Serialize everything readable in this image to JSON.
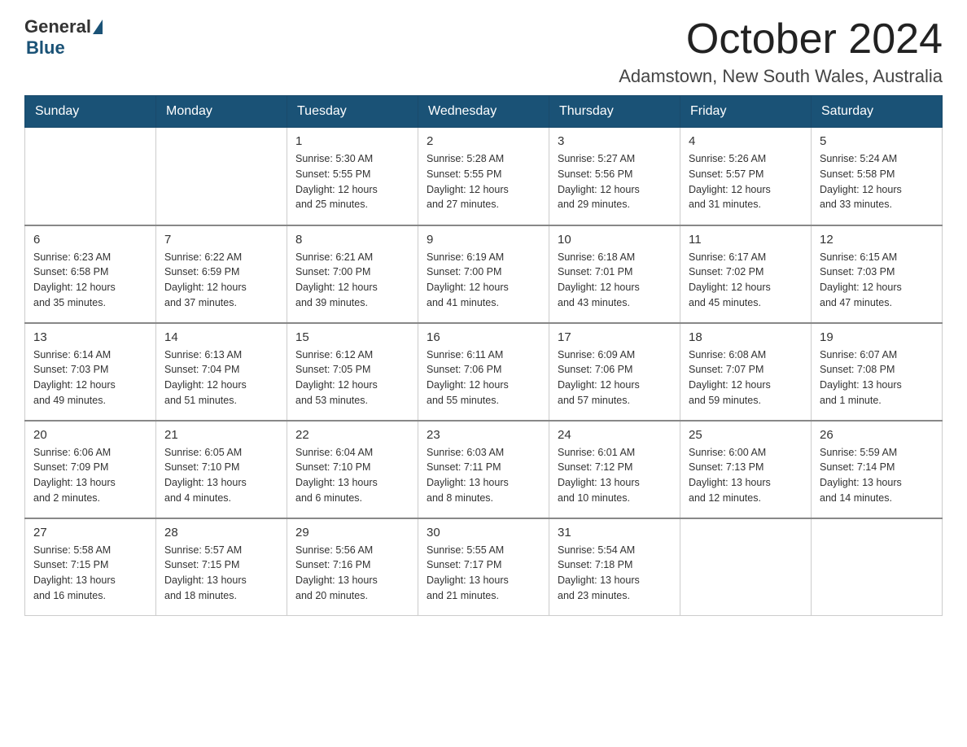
{
  "logo": {
    "general": "General",
    "blue": "Blue"
  },
  "title": "October 2024",
  "location": "Adamstown, New South Wales, Australia",
  "weekdays": [
    "Sunday",
    "Monday",
    "Tuesday",
    "Wednesday",
    "Thursday",
    "Friday",
    "Saturday"
  ],
  "weeks": [
    [
      {
        "day": "",
        "info": ""
      },
      {
        "day": "",
        "info": ""
      },
      {
        "day": "1",
        "info": "Sunrise: 5:30 AM\nSunset: 5:55 PM\nDaylight: 12 hours\nand 25 minutes."
      },
      {
        "day": "2",
        "info": "Sunrise: 5:28 AM\nSunset: 5:55 PM\nDaylight: 12 hours\nand 27 minutes."
      },
      {
        "day": "3",
        "info": "Sunrise: 5:27 AM\nSunset: 5:56 PM\nDaylight: 12 hours\nand 29 minutes."
      },
      {
        "day": "4",
        "info": "Sunrise: 5:26 AM\nSunset: 5:57 PM\nDaylight: 12 hours\nand 31 minutes."
      },
      {
        "day": "5",
        "info": "Sunrise: 5:24 AM\nSunset: 5:58 PM\nDaylight: 12 hours\nand 33 minutes."
      }
    ],
    [
      {
        "day": "6",
        "info": "Sunrise: 6:23 AM\nSunset: 6:58 PM\nDaylight: 12 hours\nand 35 minutes."
      },
      {
        "day": "7",
        "info": "Sunrise: 6:22 AM\nSunset: 6:59 PM\nDaylight: 12 hours\nand 37 minutes."
      },
      {
        "day": "8",
        "info": "Sunrise: 6:21 AM\nSunset: 7:00 PM\nDaylight: 12 hours\nand 39 minutes."
      },
      {
        "day": "9",
        "info": "Sunrise: 6:19 AM\nSunset: 7:00 PM\nDaylight: 12 hours\nand 41 minutes."
      },
      {
        "day": "10",
        "info": "Sunrise: 6:18 AM\nSunset: 7:01 PM\nDaylight: 12 hours\nand 43 minutes."
      },
      {
        "day": "11",
        "info": "Sunrise: 6:17 AM\nSunset: 7:02 PM\nDaylight: 12 hours\nand 45 minutes."
      },
      {
        "day": "12",
        "info": "Sunrise: 6:15 AM\nSunset: 7:03 PM\nDaylight: 12 hours\nand 47 minutes."
      }
    ],
    [
      {
        "day": "13",
        "info": "Sunrise: 6:14 AM\nSunset: 7:03 PM\nDaylight: 12 hours\nand 49 minutes."
      },
      {
        "day": "14",
        "info": "Sunrise: 6:13 AM\nSunset: 7:04 PM\nDaylight: 12 hours\nand 51 minutes."
      },
      {
        "day": "15",
        "info": "Sunrise: 6:12 AM\nSunset: 7:05 PM\nDaylight: 12 hours\nand 53 minutes."
      },
      {
        "day": "16",
        "info": "Sunrise: 6:11 AM\nSunset: 7:06 PM\nDaylight: 12 hours\nand 55 minutes."
      },
      {
        "day": "17",
        "info": "Sunrise: 6:09 AM\nSunset: 7:06 PM\nDaylight: 12 hours\nand 57 minutes."
      },
      {
        "day": "18",
        "info": "Sunrise: 6:08 AM\nSunset: 7:07 PM\nDaylight: 12 hours\nand 59 minutes."
      },
      {
        "day": "19",
        "info": "Sunrise: 6:07 AM\nSunset: 7:08 PM\nDaylight: 13 hours\nand 1 minute."
      }
    ],
    [
      {
        "day": "20",
        "info": "Sunrise: 6:06 AM\nSunset: 7:09 PM\nDaylight: 13 hours\nand 2 minutes."
      },
      {
        "day": "21",
        "info": "Sunrise: 6:05 AM\nSunset: 7:10 PM\nDaylight: 13 hours\nand 4 minutes."
      },
      {
        "day": "22",
        "info": "Sunrise: 6:04 AM\nSunset: 7:10 PM\nDaylight: 13 hours\nand 6 minutes."
      },
      {
        "day": "23",
        "info": "Sunrise: 6:03 AM\nSunset: 7:11 PM\nDaylight: 13 hours\nand 8 minutes."
      },
      {
        "day": "24",
        "info": "Sunrise: 6:01 AM\nSunset: 7:12 PM\nDaylight: 13 hours\nand 10 minutes."
      },
      {
        "day": "25",
        "info": "Sunrise: 6:00 AM\nSunset: 7:13 PM\nDaylight: 13 hours\nand 12 minutes."
      },
      {
        "day": "26",
        "info": "Sunrise: 5:59 AM\nSunset: 7:14 PM\nDaylight: 13 hours\nand 14 minutes."
      }
    ],
    [
      {
        "day": "27",
        "info": "Sunrise: 5:58 AM\nSunset: 7:15 PM\nDaylight: 13 hours\nand 16 minutes."
      },
      {
        "day": "28",
        "info": "Sunrise: 5:57 AM\nSunset: 7:15 PM\nDaylight: 13 hours\nand 18 minutes."
      },
      {
        "day": "29",
        "info": "Sunrise: 5:56 AM\nSunset: 7:16 PM\nDaylight: 13 hours\nand 20 minutes."
      },
      {
        "day": "30",
        "info": "Sunrise: 5:55 AM\nSunset: 7:17 PM\nDaylight: 13 hours\nand 21 minutes."
      },
      {
        "day": "31",
        "info": "Sunrise: 5:54 AM\nSunset: 7:18 PM\nDaylight: 13 hours\nand 23 minutes."
      },
      {
        "day": "",
        "info": ""
      },
      {
        "day": "",
        "info": ""
      }
    ]
  ]
}
